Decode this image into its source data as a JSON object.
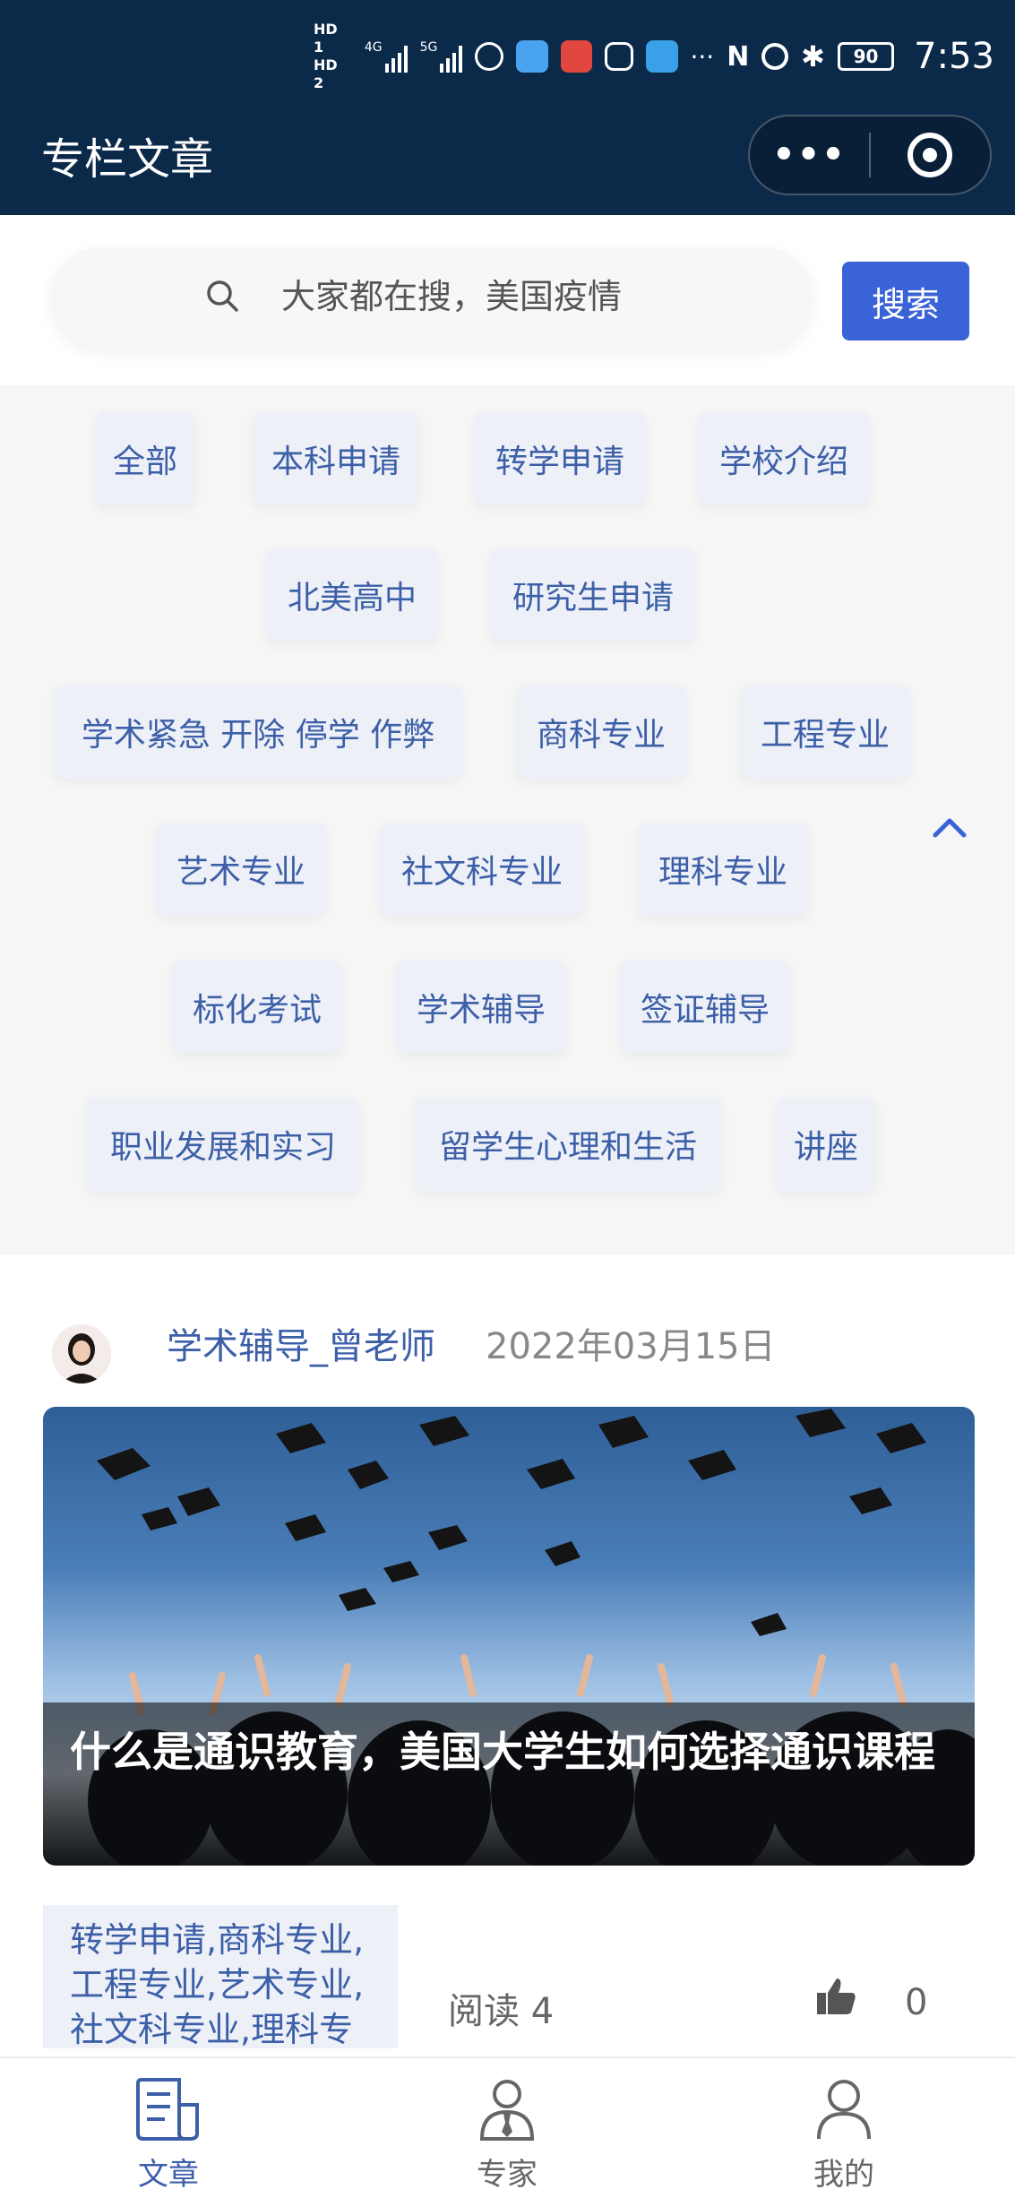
{
  "status_bar": {
    "hd1": "HD 1",
    "hd2": "HD 2",
    "net1": "4G",
    "net2": "5G",
    "battery": "90",
    "time": "7:53"
  },
  "header": {
    "title": "专栏文章",
    "more_icon": "more-dots-icon",
    "close_icon": "target-close-icon"
  },
  "search": {
    "placeholder": "大家都在搜，美国疫情",
    "button_label": "搜索"
  },
  "categories": [
    "全部",
    "本科申请",
    "转学申请",
    "学校介绍",
    "北美高中",
    "研究生申请",
    "学术紧急 开除 停学 作弊",
    "商科专业",
    "工程专业",
    "艺术专业",
    "社文科专业",
    "理科专业",
    "标化考试",
    "学术辅导",
    "签证辅导",
    "职业发展和实习",
    "留学生心理和生活",
    "讲座"
  ],
  "article": {
    "author": "学术辅导_曾老师",
    "date": "2022年03月15日",
    "title": "什么是通识教育，美国大学生如何选择通识课程",
    "tags": "转学申请,商科专业,工程专业,艺术专业,社文科专业,理科专",
    "read_label": "阅读 4",
    "likes": "0"
  },
  "bottom_nav": [
    {
      "label": "文章",
      "active": true
    },
    {
      "label": "专家",
      "active": false
    },
    {
      "label": "我的",
      "active": false
    }
  ],
  "colors": {
    "header_bg": "#0b2a4a",
    "accent": "#3b63d8",
    "tag_text": "#3c5fa8",
    "tag_bg": "#edf0f7"
  }
}
